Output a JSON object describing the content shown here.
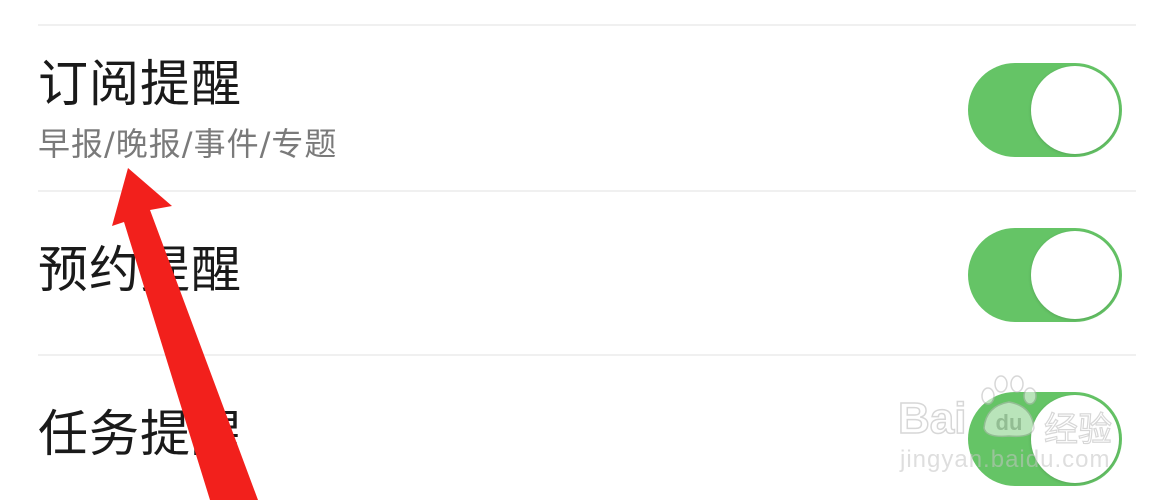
{
  "settings": {
    "items": [
      {
        "title": "订阅提醒",
        "subtitle": "早报/晚报/事件/专题",
        "enabled": true
      },
      {
        "title": "预约提醒",
        "enabled": true
      },
      {
        "title": "任务提醒",
        "enabled": true
      }
    ]
  },
  "watermark": {
    "brand": "Bai",
    "brand_du": "du",
    "jingyan": "经验",
    "url": "jingyan.baidu.com"
  },
  "colors": {
    "toggle_on": "#65c466",
    "arrow": "#f2201c",
    "divider": "#f0f0f0"
  },
  "icons": {
    "annotation": "red-arrow-icon",
    "watermark_logo": "baidu-paw-icon"
  }
}
